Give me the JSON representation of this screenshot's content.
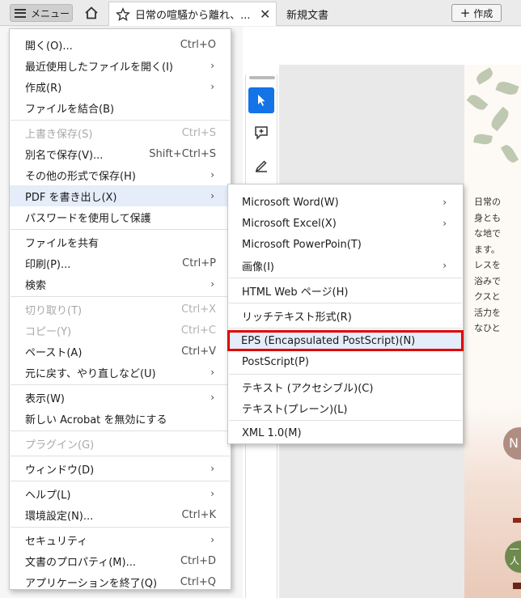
{
  "tabbar": {
    "menu_label": "メニュー",
    "active_tab_title": "日常の喧騒から離れ、...",
    "second_tab_title": "新規文書",
    "create_label": "作成"
  },
  "page_preview": {
    "text_lines": [
      "日常の",
      "身とも",
      "な地で",
      "ます。",
      "レスを",
      "浴みで",
      "クスと",
      "活力を",
      "なひと"
    ],
    "badge1": "N",
    "badge2_line1": "一",
    "badge2_line2": "人"
  },
  "main_menu": {
    "items": [
      {
        "label": "開く(O)...",
        "shortcut": "Ctrl+O"
      },
      {
        "label": "最近使用したファイルを開く(I)",
        "submenu": true
      },
      {
        "label": "作成(R)",
        "submenu": true
      },
      {
        "label": "ファイルを結合(B)"
      },
      {
        "label": "上書き保存(S)",
        "shortcut": "Ctrl+S",
        "disabled": true
      },
      {
        "label": "別名で保存(V)...",
        "shortcut": "Shift+Ctrl+S"
      },
      {
        "label": "その他の形式で保存(H)",
        "submenu": true
      },
      {
        "label": "PDF を書き出し(X)",
        "submenu": true,
        "highlighted": true
      },
      {
        "label": "パスワードを使用して保護"
      },
      {
        "label": "ファイルを共有"
      },
      {
        "label": "印刷(P)...",
        "shortcut": "Ctrl+P"
      },
      {
        "label": "検索",
        "submenu": true
      },
      {
        "label": "切り取り(T)",
        "shortcut": "Ctrl+X",
        "disabled": true
      },
      {
        "label": "コピー(Y)",
        "shortcut": "Ctrl+C",
        "disabled": true
      },
      {
        "label": "ペースト(A)",
        "shortcut": "Ctrl+V"
      },
      {
        "label": "元に戻す、やり直しなど(U)",
        "submenu": true
      },
      {
        "label": "表示(W)",
        "submenu": true
      },
      {
        "label": "新しい Acrobat を無効にする"
      },
      {
        "label": "プラグイン(G)",
        "disabled": true
      },
      {
        "label": "ウィンドウ(D)",
        "submenu": true
      },
      {
        "label": "ヘルプ(L)",
        "submenu": true
      },
      {
        "label": "環境設定(N)...",
        "shortcut": "Ctrl+K"
      },
      {
        "label": "セキュリティ",
        "submenu": true
      },
      {
        "label": "文書のプロパティ(M)...",
        "shortcut": "Ctrl+D"
      },
      {
        "label": "アプリケーションを終了(Q)",
        "shortcut": "Ctrl+Q"
      }
    ]
  },
  "export_menu": {
    "items": [
      {
        "label": "Microsoft Word(W)",
        "submenu": true
      },
      {
        "label": "Microsoft Excel(X)",
        "submenu": true
      },
      {
        "label": "Microsoft PowerPoin(T)"
      },
      {
        "label": "画像(I)",
        "submenu": true
      },
      {
        "label": "HTML Web ページ(H)"
      },
      {
        "label": "リッチテキスト形式(R)"
      },
      {
        "label": "EPS (Encapsulated PostScript)(N)",
        "highlighted": true
      },
      {
        "label": "PostScript(P)"
      },
      {
        "label": "テキスト (アクセシブル)(C)"
      },
      {
        "label": "テキスト(プレーン)(L)"
      },
      {
        "label": "XML 1.0(M)"
      }
    ]
  },
  "colors": {
    "highlight": "#e4edf9",
    "selection_box": "#e00000",
    "tool_selected": "#1473e6"
  }
}
